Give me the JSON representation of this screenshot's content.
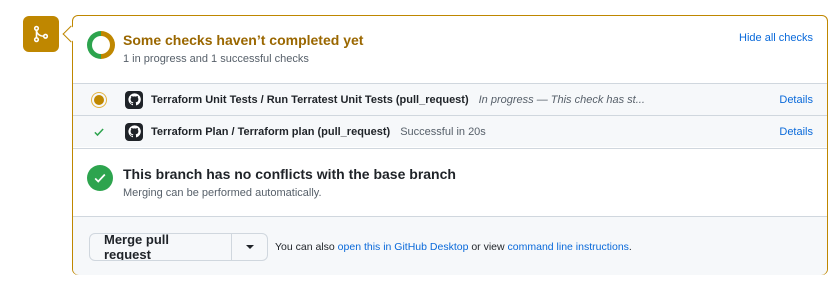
{
  "header": {
    "title": "Some checks haven’t completed yet",
    "subtitle": "1 in progress and 1 successful checks",
    "hide_link": "Hide all checks"
  },
  "checks": [
    {
      "status": "in-progress",
      "name": "Terraform Unit Tests / Run Terratest Unit Tests (pull_request)",
      "description": "In progress — This check has st...",
      "details": "Details"
    },
    {
      "status": "success",
      "name": "Terraform Plan / Terraform plan (pull_request)",
      "description": "Successful in 20s",
      "details": "Details"
    }
  ],
  "branch": {
    "title": "This branch has no conflicts with the base branch",
    "subtitle": "Merging can be performed automatically."
  },
  "merge": {
    "button_label": "Merge pull request",
    "also_prefix": "You can also",
    "desktop_link": "open this in GitHub Desktop",
    "or_view": "or view",
    "cli_link": "command line instructions",
    "period": "."
  },
  "colors": {
    "pending": "#bf8700",
    "success": "#2da44e",
    "link": "#0969da"
  },
  "icons": {
    "merge": "git-merge-icon",
    "donut": "check-status-donut-icon",
    "pending": "pending-dot-icon",
    "check": "check-icon",
    "github": "github-logo-icon",
    "caret": "caret-down-icon"
  }
}
